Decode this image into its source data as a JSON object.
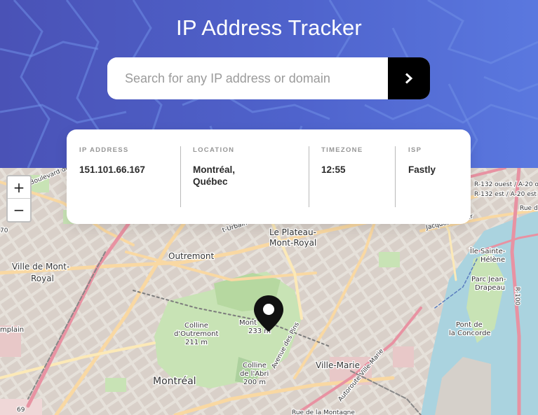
{
  "header": {
    "title": "IP Address Tracker"
  },
  "search": {
    "placeholder": "Search for any IP address or domain",
    "value": "",
    "button_icon": "chevron-right-icon"
  },
  "info": {
    "ip": {
      "label": "IP ADDRESS",
      "value": "151.101.66.167"
    },
    "location": {
      "label": "LOCATION",
      "value_line1": "Montréal,",
      "value_line2": "Québec"
    },
    "timezone": {
      "label": "TIMEZONE",
      "value": "12:55"
    },
    "isp": {
      "label": "ISP",
      "value": "Fastly"
    }
  },
  "map": {
    "zoom_in": "+",
    "zoom_out": "−",
    "marker_icon": "location-pin-icon",
    "labels": {
      "plateau_1": "Le Plateau-",
      "plateau_2": "Mont-Royal",
      "outremont": "Outremont",
      "ville_mont_royal_1": "Ville de Mont-",
      "ville_mont_royal_2": "Royal",
      "colline_outremont_1": "Colline",
      "colline_outremont_2": "d'Outremont",
      "colline_outremont_3": "211 m",
      "mont_royal_1": "Mont",
      "mont_royal_2": "233 m",
      "colline_abri_1": "Colline",
      "colline_abri_2": "de l'Abri",
      "colline_abri_3": "200 m",
      "montreal": "Montréal",
      "ville_marie": "Ville-Marie",
      "ile_sainte_helene_1": "Île Sainte-",
      "ile_sainte_helene_2": "Hélène",
      "parc_jean_drapeau_1": "Parc Jean-",
      "parc_jean_drapeau_2": "Drapeau",
      "pont_concorde_1": "Pont de",
      "pont_concorde_2": "la Concorde",
      "r132_ouest": "R-132 ouest / A-20 ou",
      "r132_est": "R-132 est / A-20 est",
      "rue_de": "Rue de",
      "boulevard_de": "Boulevard de",
      "jacques_cartier": "Jacques-Cartier",
      "st_urbain": "t-Urbain",
      "avenue_des_pins": "Avenue des Pins",
      "autoroute_ville_marie": "Autoroute Ville-Marie",
      "rue_de_la_montagne": "Rue de la Montagne",
      "champlain": "mplain",
      "r_100": "R-100",
      "seventy": "70",
      "sixtynine": "69"
    },
    "colors": {
      "park": "#c8e3b5",
      "water": "#aad3df",
      "highway": "#e892a2",
      "major": "#f9d8a2"
    }
  }
}
